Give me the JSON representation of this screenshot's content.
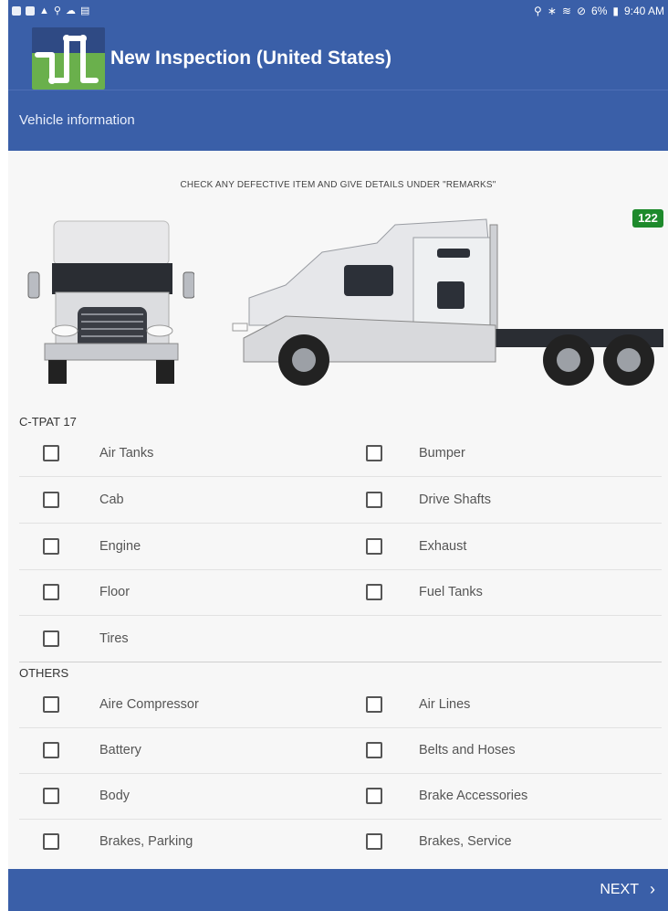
{
  "status_bar": {
    "time": "9:40 AM",
    "battery": "6%",
    "left_icons": [
      "mail-icon",
      "image-icon",
      "warning-icon",
      "usb-icon",
      "cloud-icon",
      "sim-icon"
    ],
    "right_icons": [
      "location-icon",
      "bluetooth-icon",
      "wifi-icon",
      "blocked-icon",
      "battery-icon"
    ]
  },
  "app_bar": {
    "title": "New Inspection (United States)",
    "logo_colors": {
      "background": "#2f4a84",
      "accent": "#6ab04c",
      "line": "#ffffff"
    }
  },
  "sub_header": {
    "title": "Vehicle information"
  },
  "instruction": "CHECK ANY DEFECTIVE ITEM AND GIVE DETAILS UNDER \"REMARKS\"",
  "badge": "122",
  "sections": {
    "ctpat": {
      "label": "C-TPAT 17",
      "items": [
        [
          "Air Tanks",
          "Bumper"
        ],
        [
          "Cab",
          "Drive Shafts"
        ],
        [
          "Engine",
          "Exhaust"
        ],
        [
          "Floor",
          "Fuel Tanks"
        ],
        [
          "Tires"
        ]
      ]
    },
    "others": {
      "label": "OTHERS",
      "items": [
        [
          "Aire Compressor",
          "Air Lines"
        ],
        [
          "Battery",
          "Belts and Hoses"
        ],
        [
          "Body",
          "Brake Accessories"
        ],
        [
          "Brakes, Parking",
          "Brakes, Service"
        ]
      ]
    }
  },
  "footer": {
    "next_label": "NEXT"
  },
  "colors": {
    "primary": "#3a5fa8",
    "badge": "#1e8a2c",
    "background": "#f7f7f7"
  }
}
